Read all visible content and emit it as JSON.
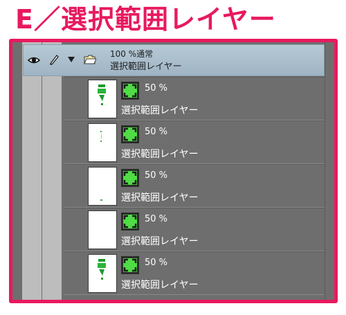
{
  "title": "E／選択範囲レイヤー",
  "group": {
    "opacity_mode": "100 %通常",
    "name": "選択範囲レイヤー"
  },
  "layers": [
    {
      "opacity": "50 %",
      "name": "選択範囲レイヤー"
    },
    {
      "opacity": "50 %",
      "name": "選択範囲レイヤー"
    },
    {
      "opacity": "50 %",
      "name": "選択範囲レイヤー"
    },
    {
      "opacity": "50 %",
      "name": "選択範囲レイヤー"
    },
    {
      "opacity": "50 %",
      "name": "選択範囲レイヤー"
    }
  ],
  "icons": {
    "visibility": "eye-icon",
    "lock": "pen-icon",
    "expand": "triangle-down-icon",
    "folder": "folder-icon",
    "selection_layer": "selection-layer-icon"
  },
  "colors": {
    "title": "#e8195f",
    "frame_border": "#e8195f",
    "panel_bg": "#6e6e6e",
    "group_header": "#aabdcb",
    "selection_icon": "#4fdc44"
  }
}
